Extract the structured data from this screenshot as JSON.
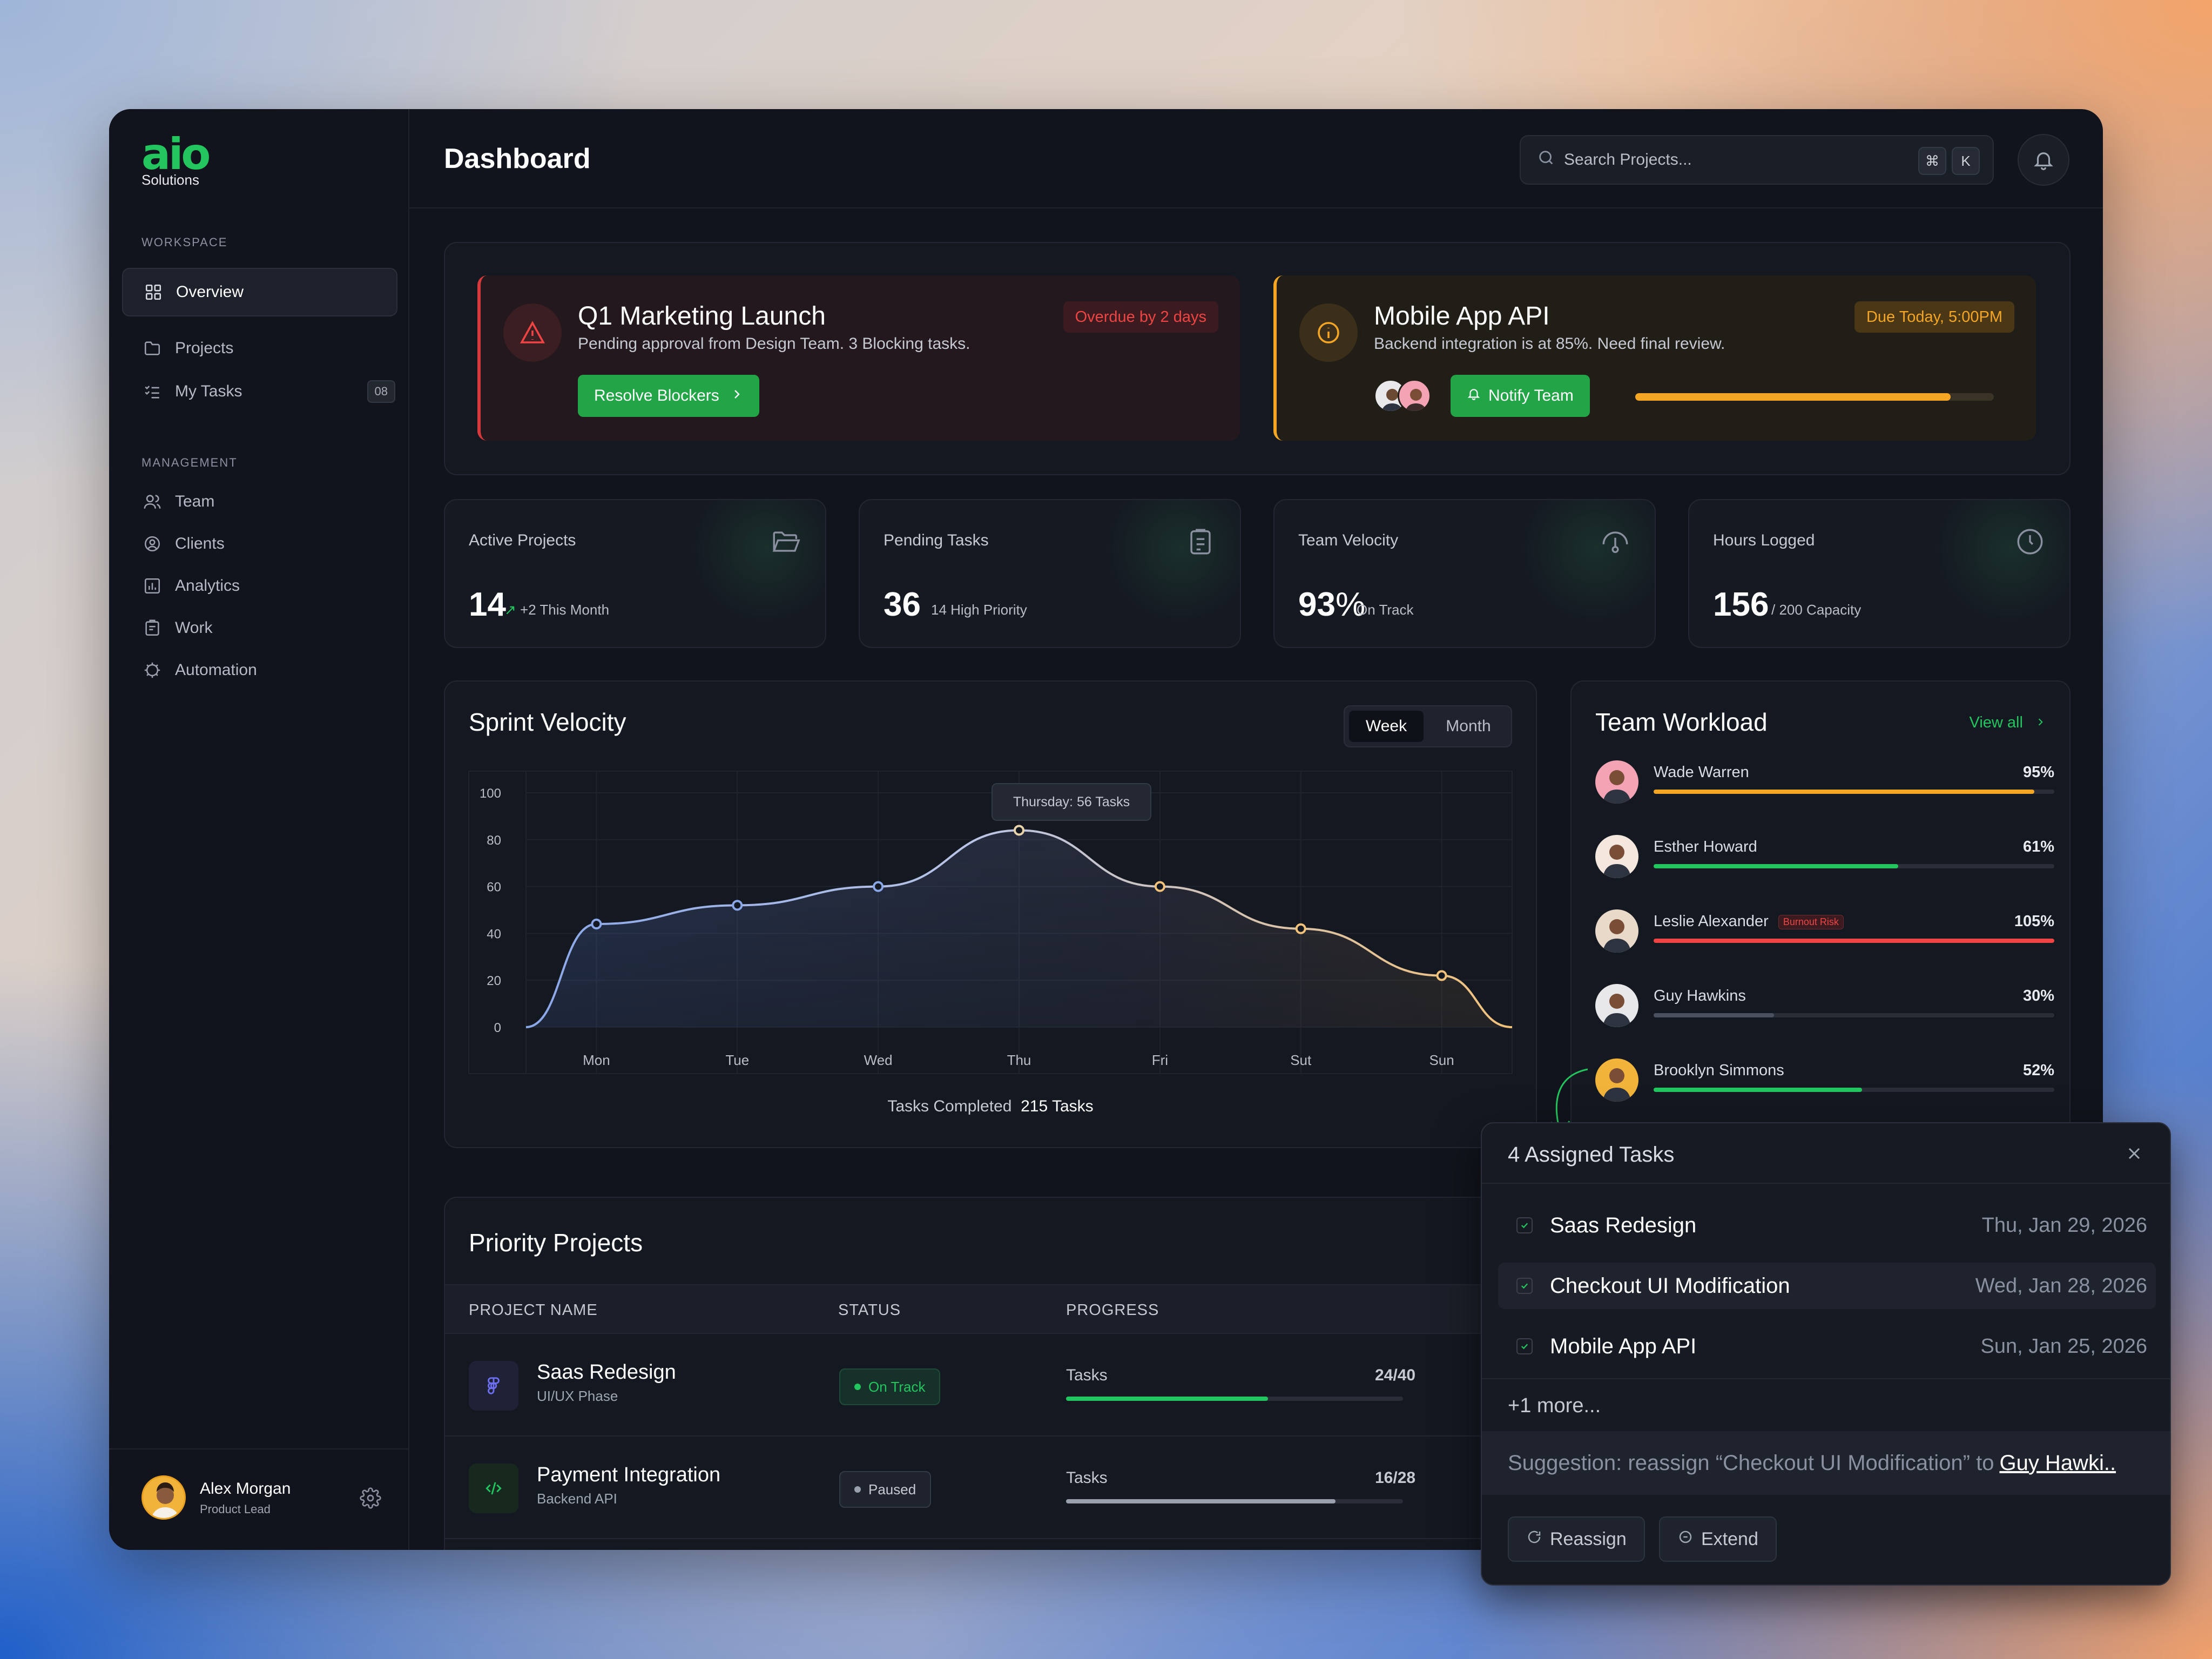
{
  "brand": {
    "logo": "aio",
    "name": "Solutions"
  },
  "sidebar": {
    "workspace_label": "WORKSPACE",
    "workspace_items": [
      {
        "label": "Overview",
        "icon": "grid-icon",
        "active": true
      },
      {
        "label": "Projects",
        "icon": "folder-icon"
      },
      {
        "label": "My Tasks",
        "icon": "checklist-icon",
        "badge": "08"
      }
    ],
    "management_label": "MANAGEMENT",
    "management_items": [
      {
        "label": "Team",
        "icon": "users-icon"
      },
      {
        "label": "Clients",
        "icon": "user-circle-icon"
      },
      {
        "label": "Analytics",
        "icon": "bar-chart-icon"
      },
      {
        "label": "Work",
        "icon": "clipboard-icon"
      },
      {
        "label": "Automation",
        "icon": "ai-gear-icon"
      }
    ],
    "user": {
      "name": "Alex Morgan",
      "role": "Product Lead"
    }
  },
  "header": {
    "title": "Dashboard",
    "search_placeholder": "Search Projects...",
    "shortcut_key1": "⌘",
    "shortcut_key2": "K"
  },
  "alerts": [
    {
      "title": "Q1 Marketing Launch",
      "desc": "Pending approval from Design Team. 3 Blocking tasks.",
      "tag": "Overdue by 2 days",
      "button": "Resolve Blockers",
      "color": "#d6393b"
    },
    {
      "title": "Mobile App API",
      "desc": "Backend integration is at 85%. Need final review.",
      "tag": "Due Today, 5:00PM",
      "button": "Notify Team",
      "progress": 0.88,
      "color": "#f5a524"
    }
  ],
  "stats": [
    {
      "label": "Active Projects",
      "value": "14",
      "sub": "+2 This Month",
      "icon": "folder-open-icon"
    },
    {
      "label": "Pending Tasks",
      "value": "36",
      "sub": "14 High Priority",
      "icon": "clipboard-list-icon"
    },
    {
      "label": "Team Velocity",
      "value": "93",
      "unit": "%",
      "sub": "On Track",
      "icon": "gauge-icon"
    },
    {
      "label": "Hours Logged",
      "value": "156",
      "sub": "/ 200 Capacity",
      "icon": "clock-icon"
    }
  ],
  "sprint": {
    "title": "Sprint Velocity",
    "toggle": [
      "Week",
      "Month"
    ],
    "tooltip": "Thursday: 56 Tasks",
    "footer_label": "Tasks Completed",
    "footer_value": "215 Tasks"
  },
  "chart_data": {
    "type": "area",
    "categories": [
      "Mon",
      "Tue",
      "Wed",
      "Thu",
      "Fri",
      "Sut",
      "Sun"
    ],
    "values": [
      44,
      52,
      60,
      84,
      60,
      42,
      22
    ],
    "ylim": [
      0,
      100
    ],
    "yticks": [
      0,
      20,
      40,
      60,
      80,
      100
    ],
    "gradient_colors": [
      "#8aa7e8",
      "#f2c27a"
    ]
  },
  "workload": {
    "title": "Team Workload",
    "view_all": "View all",
    "members": [
      {
        "name": "Wade Warren",
        "pct": "95%",
        "value": 0.95,
        "color": "#f5a524",
        "avatar_bg": "#f4a3b4"
      },
      {
        "name": "Esther Howard",
        "pct": "61%",
        "value": 0.61,
        "color": "#22c55e",
        "avatar_bg": "#f3e7de"
      },
      {
        "name": "Leslie Alexander",
        "pct": "105%",
        "value": 1.0,
        "color": "#ef4444",
        "avatar_bg": "#e8d9c9",
        "badge": "Burnout Risk"
      },
      {
        "name": "Guy Hawkins",
        "pct": "30%",
        "value": 0.3,
        "color": "#4b5060",
        "avatar_bg": "#e8e8ea"
      },
      {
        "name": "Brooklyn Simmons",
        "pct": "52%",
        "value": 0.52,
        "color": "#22c55e",
        "avatar_bg": "#f2b33a"
      }
    ]
  },
  "priority": {
    "title": "Priority Projects",
    "columns": [
      "PROJECT NAME",
      "STATUS",
      "PROGRESS"
    ],
    "rows": [
      {
        "name": "Saas Redesign",
        "phase": "UI/UX Phase",
        "status": "On Track",
        "tasks_label": "Tasks",
        "count": "24/40",
        "progress": 0.6,
        "bar_color": "#22c55e",
        "icon": "figma-icon"
      },
      {
        "name": "Payment Integration",
        "phase": "Backend API",
        "status": "Paused",
        "tasks_label": "Tasks",
        "count": "16/28",
        "progress": 0.8,
        "bar_color": "#9aa0ad",
        "icon": "code-icon"
      }
    ]
  },
  "popup": {
    "title": "4 Assigned Tasks",
    "tasks": [
      {
        "name": "Saas Redesign",
        "date": "Thu, Jan 29, 2026"
      },
      {
        "name": "Checkout UI Modification",
        "date": "Wed, Jan 28, 2026"
      },
      {
        "name": "Mobile App API",
        "date": "Sun, Jan 25, 2026"
      }
    ],
    "more": "+1 more...",
    "suggestion": "Suggestion: reassign “Checkout UI Modification” to",
    "suggestion_link": "Guy Hawki..",
    "reassign": "Reassign",
    "extend": "Extend"
  }
}
